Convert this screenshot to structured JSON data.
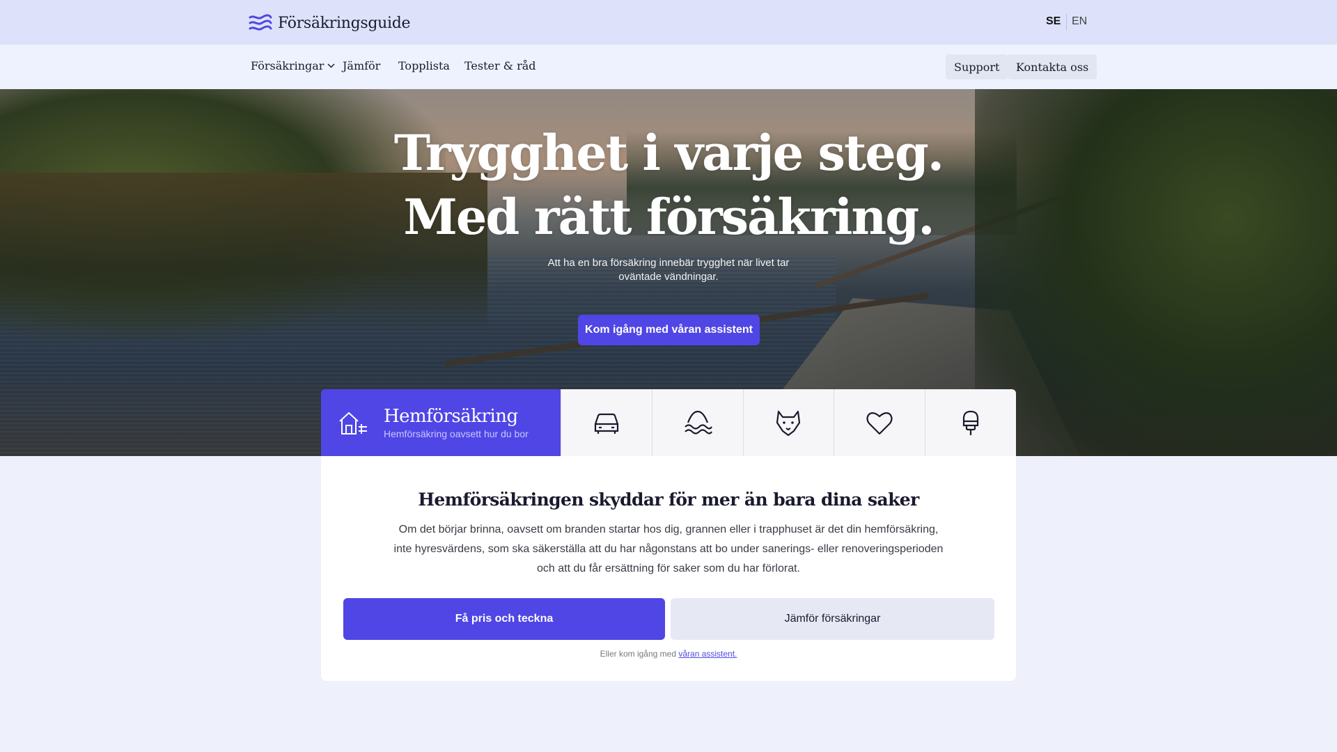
{
  "brand": {
    "name": "Försäkringsguide"
  },
  "lang": {
    "se": "SE",
    "en": "EN",
    "active": "SE"
  },
  "nav": {
    "items": [
      "Försäkringar",
      "Jämför",
      "Topplista",
      "Tester & råd"
    ],
    "support": "Support",
    "contact": "Kontakta oss"
  },
  "hero": {
    "title_line1": "Trygghet i varje steg.",
    "title_line2": "Med rätt försäkring.",
    "subtitle": "Att ha en bra försäkring innebär trygghet när livet tar oväntade vändningar.",
    "cta": "Kom igång med våran assistent"
  },
  "categories": {
    "active": {
      "title": "Hemförsäkring",
      "desc": "Hemförsäkring oavsett hur du bor",
      "icon": "home-icon"
    },
    "others": [
      "car-icon",
      "water-icon",
      "pet-icon",
      "heart-icon",
      "accident-icon"
    ]
  },
  "card": {
    "title": "Hemförsäkringen skyddar för mer än bara dina saker",
    "body": "Om det börjar brinna, oavsett om branden startar hos dig, grannen eller i trapphuset är det din hemförsäkring, inte hyresvärdens, som ska säkerställa att du har någonstans att bo under sanerings- eller renoveringsperioden och att du får ersättning för saker som du har förlorat.",
    "primary": "Få pris och teckna",
    "secondary": "Jämför försäkringar",
    "footer_text": "Eller kom igång med",
    "footer_link": "våran assistent."
  },
  "colors": {
    "accent": "#4f46e5",
    "topbar": "#dde2fa",
    "navbar": "#eef1fe",
    "background": "#eef0fc"
  }
}
